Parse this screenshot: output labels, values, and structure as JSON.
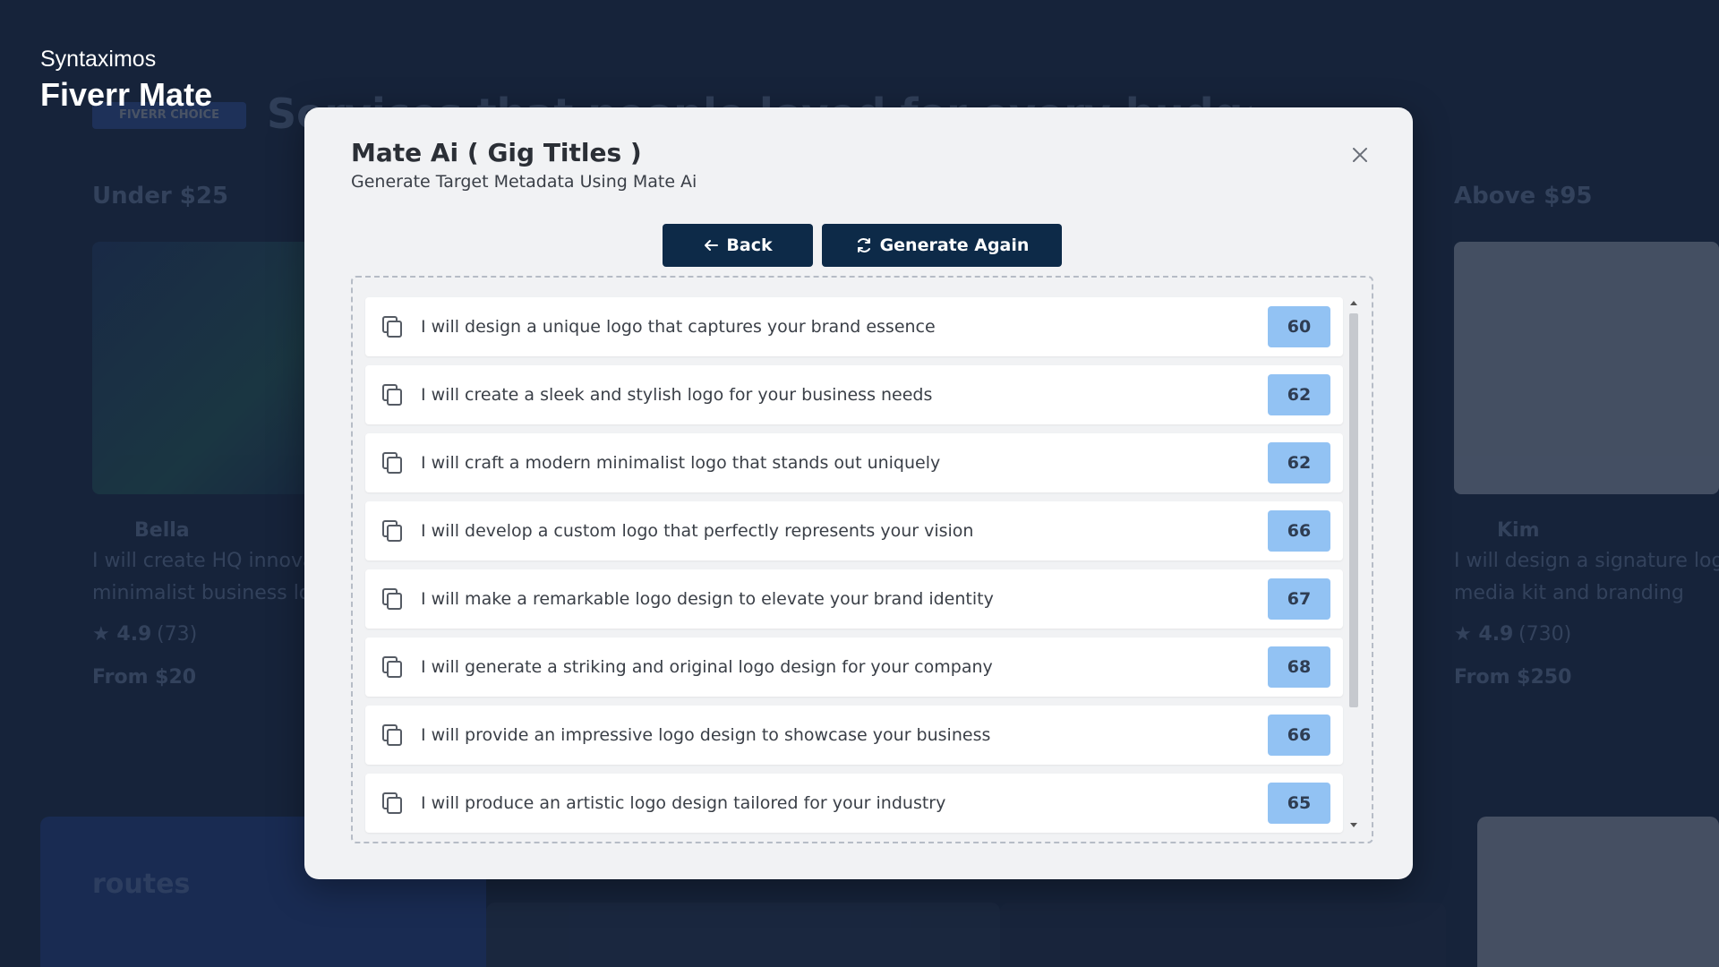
{
  "background": {
    "heading": "Services that people loved for every budget and delivery",
    "pill": "FIVERR CHOICE",
    "columns": {
      "left_title": "Under $25",
      "right_title": "Above $95"
    },
    "left_card": {
      "seller": "Bella",
      "desc_line1": "I will create HQ innovative",
      "desc_line2": "minimalist business logo",
      "rating": "★ 4.9",
      "reviews": "(73)",
      "price": "From $20"
    },
    "right_card": {
      "seller": "Kim",
      "desc_line1": "I will design a signature logo",
      "desc_line2": "media kit and branding",
      "rating": "★ 4.9",
      "reviews": "(730)",
      "price": "From $250"
    },
    "routes_label": "routes"
  },
  "brand": {
    "subtitle": "Syntaximos",
    "title": "Fiverr Mate"
  },
  "modal": {
    "title": "Mate Ai ( Gig Titles )",
    "subtitle": "Generate Target Metadata Using Mate Ai",
    "close_icon": "close-icon",
    "back_label": "Back",
    "back_icon": "arrow-left-icon",
    "generate_label": "Generate Again",
    "generate_icon": "refresh-icon",
    "titles": [
      {
        "text": "I will design a unique logo that captures your brand essence",
        "count": "60"
      },
      {
        "text": "I will create a sleek and stylish logo for your business needs",
        "count": "62"
      },
      {
        "text": "I will craft a modern minimalist logo that stands out uniquely",
        "count": "62"
      },
      {
        "text": "I will develop a custom logo that perfectly represents your vision",
        "count": "66"
      },
      {
        "text": "I will make a remarkable logo design to elevate your brand identity",
        "count": "67"
      },
      {
        "text": "I will generate a striking and original logo design for your company",
        "count": "68"
      },
      {
        "text": "I will provide an impressive logo design to showcase your business",
        "count": "66"
      },
      {
        "text": "I will produce an artistic logo design tailored for your industry",
        "count": "65"
      }
    ]
  },
  "colors": {
    "page_background": "#16233a",
    "modal_background": "#f1f2f4",
    "button": "#0d2a48",
    "count_badge": "#92c2f3"
  }
}
